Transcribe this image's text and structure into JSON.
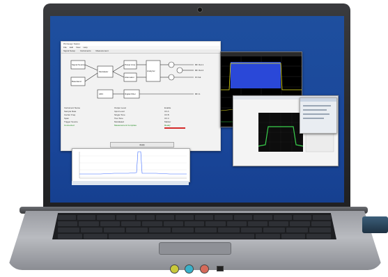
{
  "app": {
    "title": "PA Design Station",
    "menu": [
      "File",
      "Edit",
      "View",
      "Help"
    ],
    "tabs": [
      "Signal Setup",
      "Instruments",
      "Measurement"
    ]
  },
  "diagram": {
    "blocks": [
      "Signal Source",
      "Baseband",
      "Modulator",
      "Power Amp",
      "Attenuator",
      "Analyzer",
      "ADC",
      "Digital Filter"
    ],
    "outputs": [
      "RF Out 1",
      "RF Out 2",
      "IF Out"
    ],
    "inputs": [
      "RF In"
    ]
  },
  "left_panel": {
    "rows": [
      "Instrument Name",
      "Sample Rate",
      "Carrier Freq",
      "Span",
      "Trigger Source"
    ],
    "green": "Connected"
  },
  "mid_panel": {
    "rows": [
      "Output Level",
      "Input Level",
      "Single Tone",
      "Two Tone",
      "Modulated"
    ],
    "green": "Measurement Complete"
  },
  "right_panel": {
    "rows": [
      "Enable",
      "Ch A",
      "Ch B",
      "Ch C",
      "Marker"
    ],
    "green": "Ready"
  },
  "apply": "Apply",
  "colors": {
    "screen": "#1a479b",
    "trace_yellow": "#e8e320",
    "trace_blue": "#3d6bff",
    "trace_green": "#3ad14d",
    "status_red": "#d42a2a",
    "status_green": "#1b8a1b"
  },
  "icons": [
    "webcam-icon",
    "audio-jack-icon",
    "usb-cable-icon"
  ]
}
